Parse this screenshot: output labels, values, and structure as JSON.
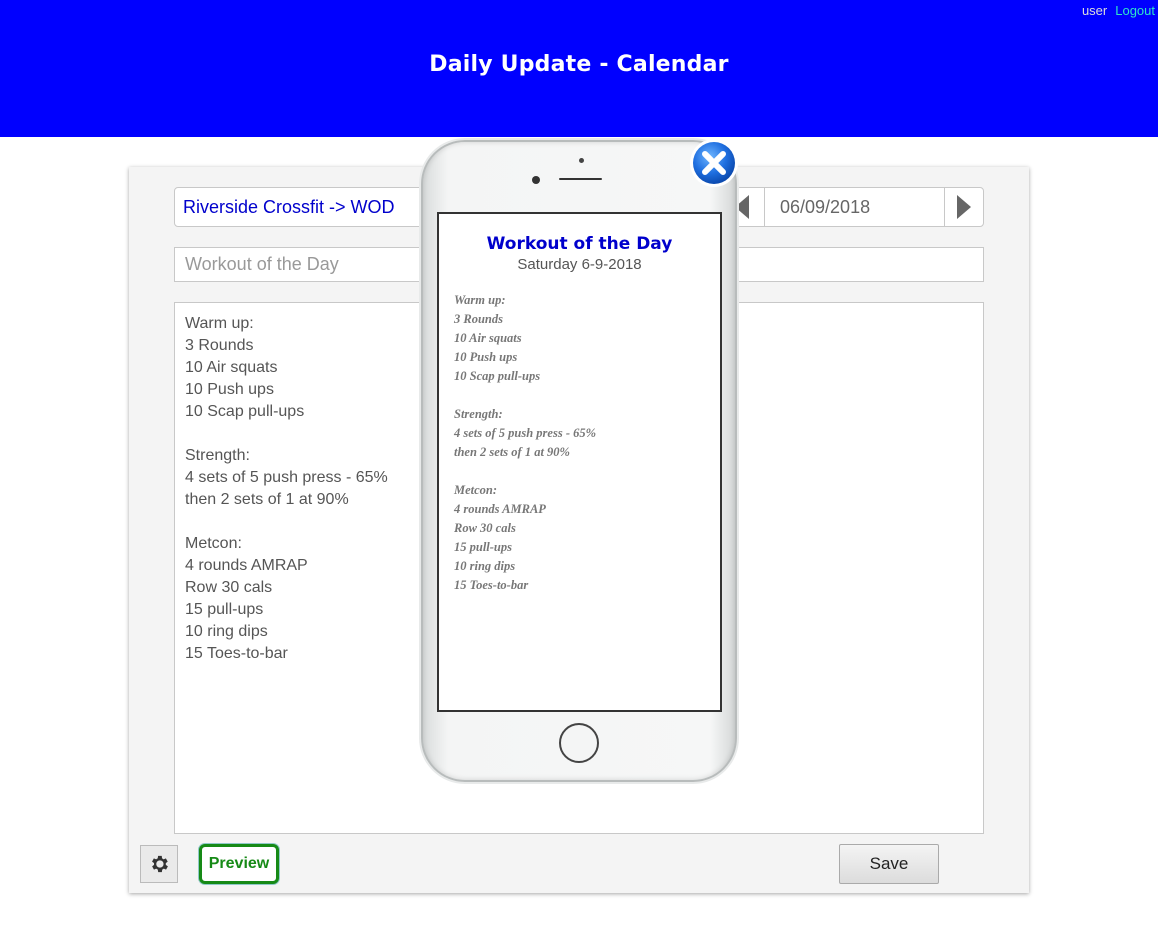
{
  "header": {
    "title": "Daily Update - Calendar",
    "user": "user",
    "logout": "Logout",
    "bg_color": "#0000ff"
  },
  "editor": {
    "location": "Riverside Crossfit -> WOD",
    "date": "06/09/2018",
    "title_placeholder": "Workout of the Day",
    "workout_text": "Warm up:\n3 Rounds\n10 Air squats\n10 Push ups\n10 Scap pull-ups\n\nStrength:\n4 sets of 5 push press - 65%\nthen 2 sets of 1 at 90%\n\nMetcon:\n4 rounds AMRAP\nRow 30 cals\n15 pull-ups\n10 ring dips\n15 Toes-to-bar"
  },
  "buttons": {
    "preview": "Preview",
    "save": "Save",
    "settings_icon": "gear-icon",
    "close_icon": "close-icon",
    "prev_icon": "triangle-left-icon",
    "next_icon": "triangle-right-icon"
  },
  "preview": {
    "title": "Workout of the Day",
    "date": "Saturday 6-9-2018",
    "body": "Warm up:\n3 Rounds\n10 Air squats\n10 Push ups\n10 Scap pull-ups\n\nStrength:\n4 sets of 5 push press - 65%\nthen 2 sets of 1 at 90%\n\nMetcon:\n4 rounds AMRAP\nRow 30 cals\n15 pull-ups\n10 ring dips\n15 Toes-to-bar"
  },
  "colors": {
    "link_blue": "#0000cc",
    "preview_green": "#168a16",
    "logout_teal": "#2ee6c8"
  }
}
